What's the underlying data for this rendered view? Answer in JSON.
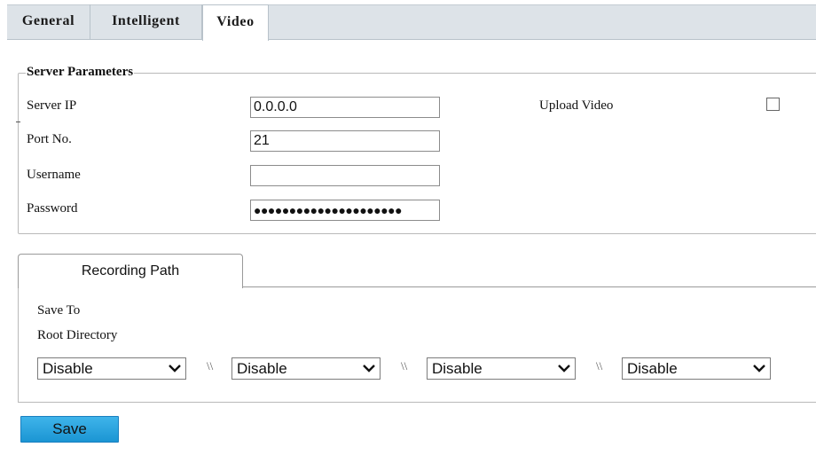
{
  "tabs": [
    {
      "label": "General",
      "active": false
    },
    {
      "label": "Intelligent",
      "active": false
    },
    {
      "label": "Video",
      "active": true
    }
  ],
  "server_parameters": {
    "legend": "Server Parameters",
    "server_ip_label": "Server IP",
    "server_ip_value": "0.0.0.0",
    "port_label": "Port No.",
    "port_value": "21",
    "username_label": "Username",
    "username_value": "",
    "password_label": "Password",
    "password_mask": "●●●●●●●●●●●●●●●●●●●●●",
    "upload_video_label": "Upload Video",
    "upload_video_checked": false
  },
  "recording_path": {
    "tab_label": "Recording Path",
    "save_to_label": "Save To",
    "root_directory_label": "Root Directory",
    "separator": "\\\\",
    "directories": [
      "Disable",
      "Disable",
      "Disable",
      "Disable"
    ]
  },
  "save_label": "Save",
  "colors": {
    "tabbar_bg": "#dde3e8",
    "save_button": "#1b95d3"
  }
}
